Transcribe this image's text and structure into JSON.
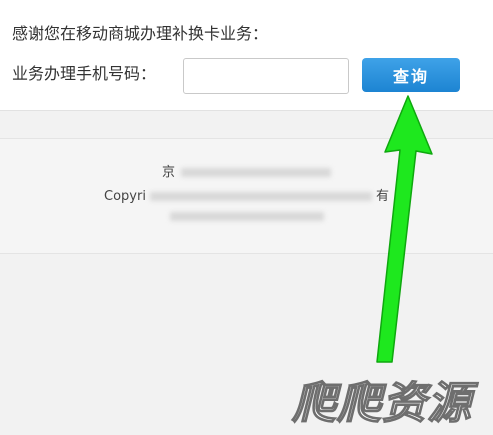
{
  "form": {
    "intro_text": "感谢您在移动商城办理补换卡业务：",
    "phone_label": "业务办理手机号码：",
    "phone_value": "",
    "phone_placeholder": "",
    "query_button_label": "查询"
  },
  "footer": {
    "line1_prefix": "京",
    "line2_prefix": "Copyri",
    "line2_suffix": "有"
  },
  "annotation": {
    "arrow_color": "#1ee81e",
    "arrow_target": "query-button"
  },
  "watermark": {
    "text": "爬爬资源"
  },
  "colors": {
    "button_blue": "#2a8fdd",
    "panel_background": "#ffffff",
    "page_background": "#f2f2f2"
  }
}
